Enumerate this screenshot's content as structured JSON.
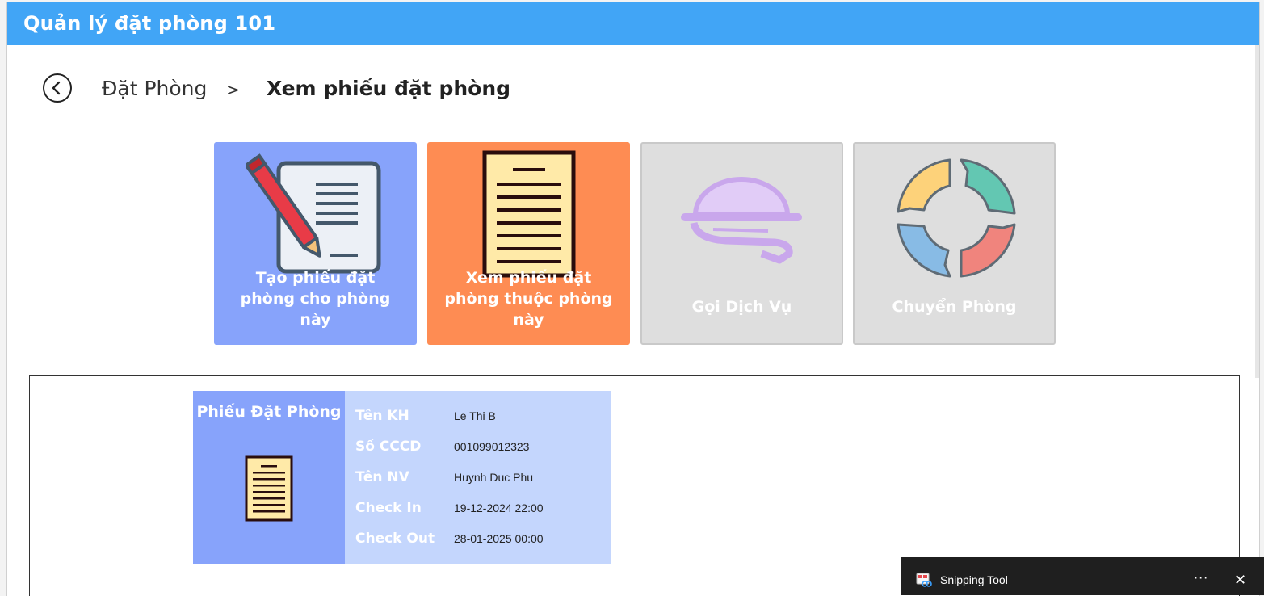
{
  "window": {
    "title": "Quản lý đặt phòng 101"
  },
  "breadcrumb": {
    "parent": "Đặt Phòng",
    "separator": ">",
    "current": "Xem phiếu đặt phòng"
  },
  "tiles": [
    {
      "label": "Tạo phiếu đặt phòng cho phòng này",
      "color": "#87a3fb",
      "icon": "document-pencil-icon"
    },
    {
      "label": "Xem phiếu đặt phòng thuộc phòng này",
      "color": "#fe8c53",
      "icon": "document-icon"
    },
    {
      "label": "Gọi Dịch Vụ",
      "color": "#dedede",
      "icon": "food-service-icon"
    },
    {
      "label": "Chuyển Phòng",
      "color": "#dedede",
      "icon": "cycle-arrows-icon"
    }
  ],
  "booking_card": {
    "title": "Phiếu Đặt Phòng",
    "rows": [
      {
        "key": "Tên KH",
        "value": "Le Thi B"
      },
      {
        "key": "Số CCCD",
        "value": "001099012323"
      },
      {
        "key": "Tên NV",
        "value": "Huynh Duc Phu"
      },
      {
        "key": "Check In",
        "value": "19-12-2024 22:00"
      },
      {
        "key": "Check Out",
        "value": "28-01-2025 00:00"
      }
    ]
  },
  "snipping_tool": {
    "title": "Snipping Tool",
    "more": "···",
    "close": "✕"
  }
}
